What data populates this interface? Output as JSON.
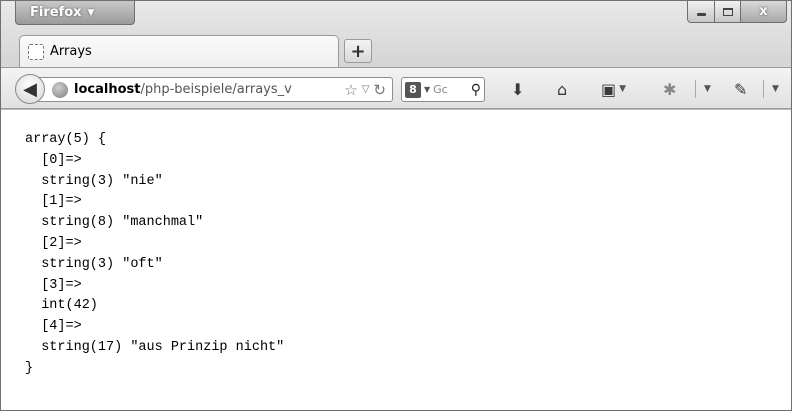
{
  "window": {
    "app_button_label": "Firefox",
    "close_glyph": "x"
  },
  "tab": {
    "title": "Arrays"
  },
  "newtab": {
    "label": "+"
  },
  "navbar": {
    "url_host": "localhost",
    "url_path": "/php-beispiele/arrays_v",
    "search_engine_icon": "8",
    "search_placeholder": "Gc",
    "icons": [
      "back-arrow-icon",
      "globe-icon",
      "bookmark-star-icon",
      "dropdown-arrow-icon",
      "reload-icon",
      "search-engine-icon",
      "magnifier-icon",
      "downloads-icon",
      "home-icon",
      "bookmarks-menu-icon",
      "addon-icon",
      "tools-icon"
    ]
  },
  "content": {
    "lines": [
      "array(5) {",
      "  [0]=>",
      "  string(3) \"nie\"",
      "  [1]=>",
      "  string(8) \"manchmal\"",
      "  [2]=>",
      "  string(3) \"oft\"",
      "  [3]=>",
      "  int(42)",
      "  [4]=>",
      "  string(17) \"aus Prinzip nicht\"",
      "}"
    ]
  }
}
